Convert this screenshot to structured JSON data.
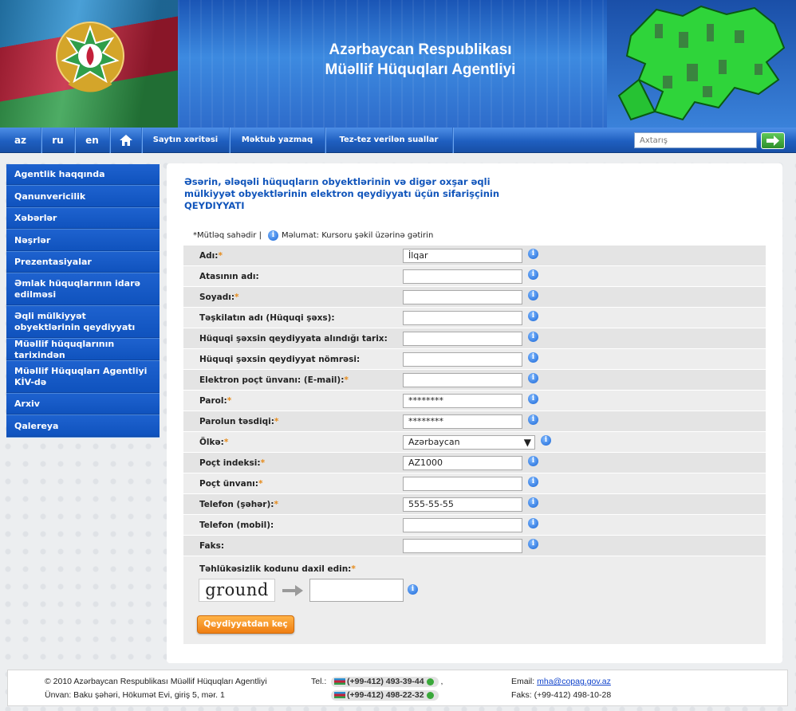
{
  "header": {
    "title_line1": "Azərbaycan Respublikası",
    "title_line2": "Müəllif Hüquqları Agentliyi"
  },
  "nav": {
    "languages": [
      "az",
      "ru",
      "en"
    ],
    "items": [
      "Saytın xəritəsi",
      "Məktub yazmaq",
      "Tez-tez verilən suallar"
    ],
    "search_placeholder": "Axtarış"
  },
  "sidebar": {
    "items": [
      "Agentlik haqqında",
      "Qanunvericilik",
      "Xəbərlər",
      "Nəşrlər",
      "Prezentasiyalar",
      "Əmlak hüquqlarının idarə edilməsi",
      "Əqli mülkiyyət obyektlərinin qeydiyyatı",
      "Müəllif hüquqlarının tarixindən",
      "Müəllif Hüquqları Agentliyi KİV-də",
      "Arxiv",
      "Qalereya"
    ]
  },
  "form": {
    "heading": "Əsərin, ələqəli hüquqların obyektlərinin və digər oxşar əqli mülkiyyət obyektlərinin elektron qeydiyyatı üçün sifarişçinin QEYDIYYATI",
    "legend_required": "*Mütləq sahədir |",
    "legend_info": "Məlumat: Kursoru şəkil üzərinə gətirin",
    "fields": [
      {
        "label": "Adı:",
        "required": true,
        "value": "İlqar"
      },
      {
        "label": "Atasının adı:",
        "required": false,
        "value": ""
      },
      {
        "label": "Soyadı:",
        "required": true,
        "value": ""
      },
      {
        "label": "Təşkilatın adı (Hüquqi şəxs):",
        "required": false,
        "value": ""
      },
      {
        "label": "Hüquqi şəxsin qeydiyyata alındığı tarix:",
        "required": false,
        "value": ""
      },
      {
        "label": "Hüquqi şəxsin qeydiyyat nömrəsi:",
        "required": false,
        "value": ""
      },
      {
        "label": "Elektron poçt ünvanı: (E-mail):",
        "required": true,
        "value": ""
      },
      {
        "label": "Parol:",
        "required": true,
        "value": "********"
      },
      {
        "label": "Parolun təsdiqi:",
        "required": true,
        "value": "********"
      },
      {
        "label": "Ölkə:",
        "required": true,
        "value": "Azərbaycan",
        "select": true
      },
      {
        "label": "Poçt indeksi:",
        "required": true,
        "value": "AZ1000"
      },
      {
        "label": "Poçt ünvanı:",
        "required": true,
        "value": ""
      },
      {
        "label": "Telefon (şəhər):",
        "required": true,
        "value": "555-55-55"
      },
      {
        "label": "Telefon (mobil):",
        "required": false,
        "value": ""
      },
      {
        "label": "Faks:",
        "required": false,
        "value": ""
      }
    ],
    "captcha_label": "Təhlükəsizlik kodunu daxil edin:",
    "captcha_text": "ground",
    "captcha_value": "",
    "submit_label": "Qeydiyyatdan keç"
  },
  "footer": {
    "copyright": "© 2010 Azərbaycan Respublikası Müəllif Hüquqları Agentliyi",
    "address": "Ünvan: Baku şəhəri, Hökumət Evi, giriş 5, mər. 1",
    "tel_label": "Tel.:",
    "phone1": "(+99-412) 493-39-44",
    "phone2": "(+99-412) 498-22-32",
    "email_label": "Email:",
    "email": "mha@copag.gov.az",
    "fax": "Faks: (+99-412) 498-10-28"
  },
  "colors": {
    "accent": "#1256c4",
    "button": "#ef7e12",
    "required": "#e58a1a"
  }
}
